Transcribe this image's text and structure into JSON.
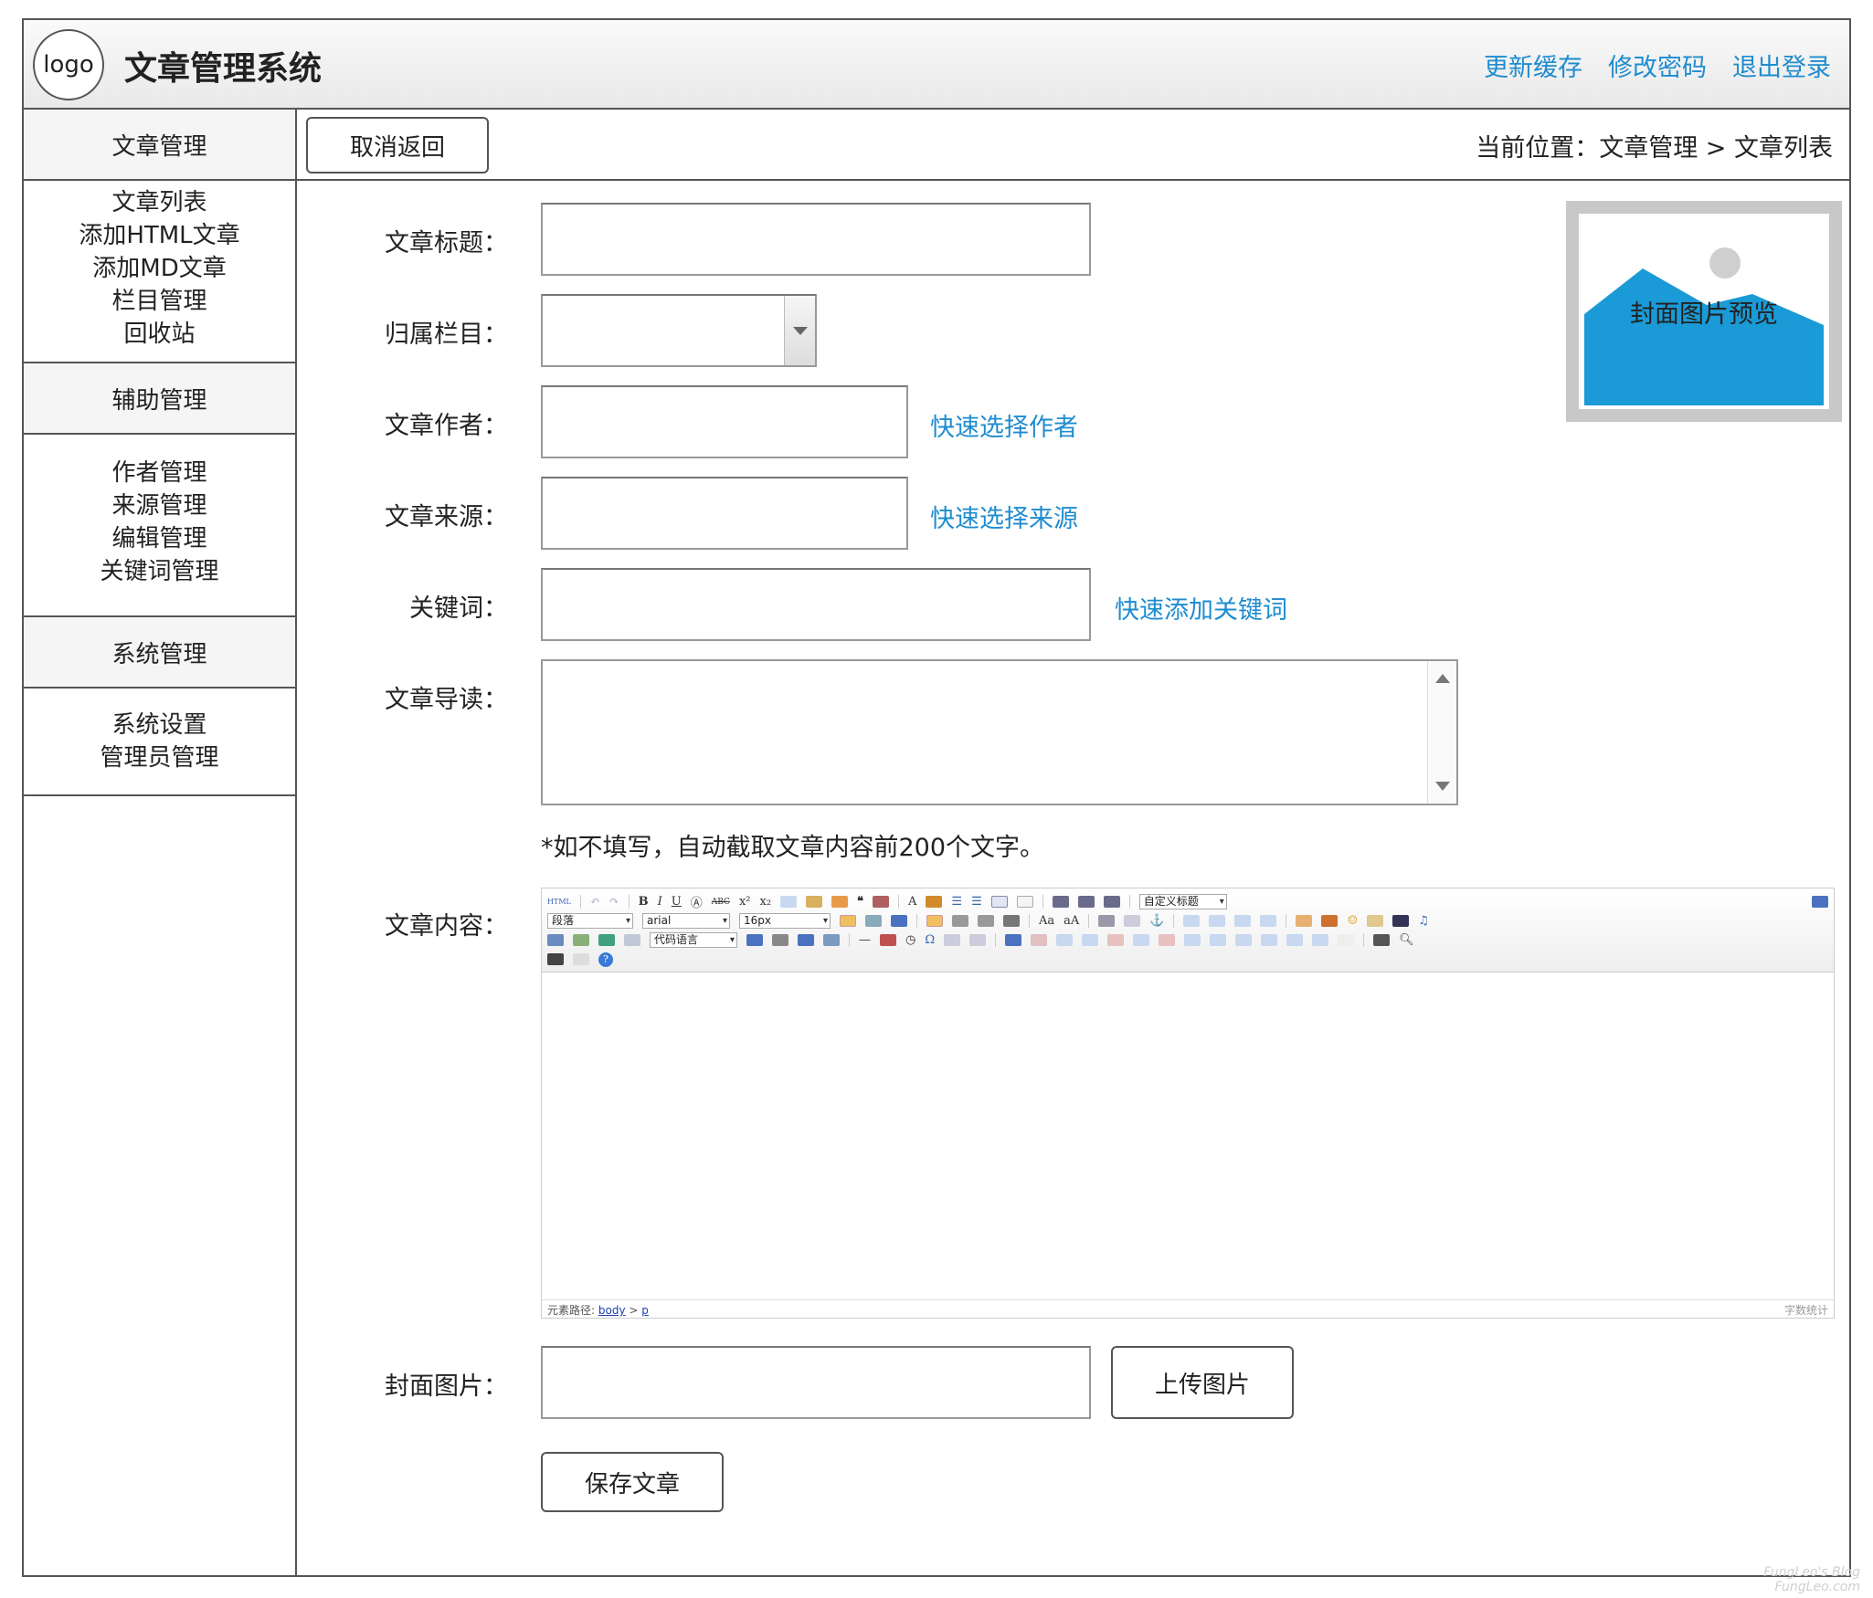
{
  "header": {
    "logo": "logo",
    "title": "文章管理系统",
    "links": [
      "更新缓存",
      "修改密码",
      "退出登录"
    ]
  },
  "sidebar": {
    "section1": "文章管理",
    "items1": [
      "文章列表",
      "添加HTML文章",
      "添加MD文章",
      "栏目管理",
      "回收站"
    ],
    "section2": "辅助管理",
    "items2": [
      "作者管理",
      "来源管理",
      "编辑管理",
      "关键词管理"
    ],
    "section3": "系统管理",
    "items3": [
      "系统设置",
      "管理员管理"
    ]
  },
  "topbar": {
    "back_button": "取消返回",
    "breadcrumb": "当前位置：文章管理 > 文章列表"
  },
  "form": {
    "title_label": "文章标题：",
    "title_value": "",
    "column_label": "归属栏目：",
    "column_value": "",
    "author_label": "文章作者：",
    "author_value": "",
    "author_link": "快速选择作者",
    "source_label": "文章来源：",
    "source_value": "",
    "source_link": "快速选择来源",
    "keywords_label": "关键词：",
    "keywords_value": "",
    "keywords_link": "快速添加关键词",
    "summary_label": "文章导读：",
    "summary_value": "",
    "summary_hint": "*如不填写，自动截取文章内容前200个文字。",
    "content_label": "文章内容：",
    "cover_label": "封面图片：",
    "cover_value": "",
    "upload_button": "上传图片",
    "save_button": "保存文章"
  },
  "editor": {
    "html_button": "HTML",
    "paragraph_select": "段落",
    "font_select": "arial",
    "size_select": "16px",
    "code_lang_select": "代码语言",
    "custom_heading_select": "自定义标题",
    "status_path_label": "元素路径:",
    "status_path_body": "body",
    "status_path_sep": ">",
    "status_path_p": "p",
    "word_count": "字数统计"
  },
  "cover_preview": {
    "text": "封面图片预览",
    "accent": "#1a9ad6"
  },
  "watermark": [
    "FungLeo's Blog",
    "FungLeo.com"
  ]
}
